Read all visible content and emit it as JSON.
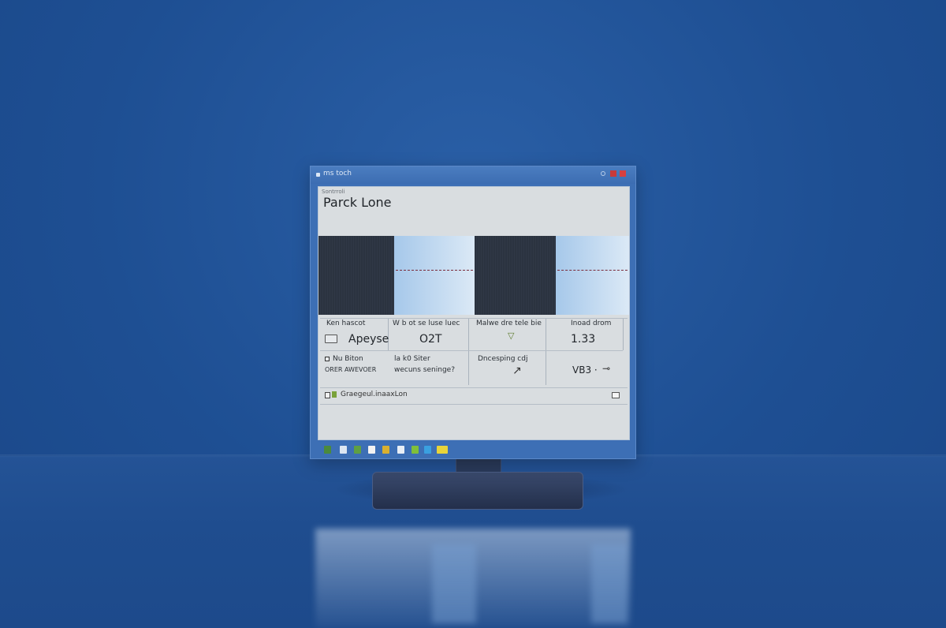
{
  "window": {
    "title": "ms toch",
    "section_label": "Sontrroli",
    "page_title": "Parck Lone"
  },
  "stats": {
    "row1": [
      {
        "header": "Ken hascot",
        "value": "Apeyse"
      },
      {
        "header": "W b ot se luse luec",
        "value": "O2T"
      },
      {
        "header": "Malwe dre tele bie",
        "icon": "triangle-down-icon"
      },
      {
        "header": "Inoad drom",
        "value": "1.33"
      }
    ],
    "row2": [
      {
        "line1": "Nu Biton",
        "line2": "ORER AWEVOER"
      },
      {
        "line1": "la k0 Siter",
        "line2": "wecuns seninge?"
      },
      {
        "line1": "Dncesping cdj",
        "icon": "curve-icon"
      },
      {
        "value": "VB3 ·",
        "icon": "connector-icon"
      }
    ]
  },
  "statusbar": {
    "text": "Graegeul.inaaxLon"
  },
  "colors": {
    "background": "#1e4f93",
    "window_frame": "#3d6fb5",
    "close_button": "#d74040",
    "content_bg": "#d9dde0"
  },
  "taskbar_icons": [
    {
      "name": "list-icon",
      "color": "#4b8a3c"
    },
    {
      "name": "folder-icon",
      "color": "#dce6f2"
    },
    {
      "name": "image-icon",
      "color": "#5fa043"
    },
    {
      "name": "c-app-icon",
      "color": "#f2f2f2"
    },
    {
      "name": "grid-icon",
      "color": "#d9b030"
    },
    {
      "name": "mail-icon",
      "color": "#e8eef6"
    },
    {
      "name": "green-x-icon",
      "color": "#7fbf3a"
    },
    {
      "name": "blue-app-icon",
      "color": "#3aa0e0"
    },
    {
      "name": "yellow-note-icon",
      "color": "#e8d43a"
    }
  ]
}
